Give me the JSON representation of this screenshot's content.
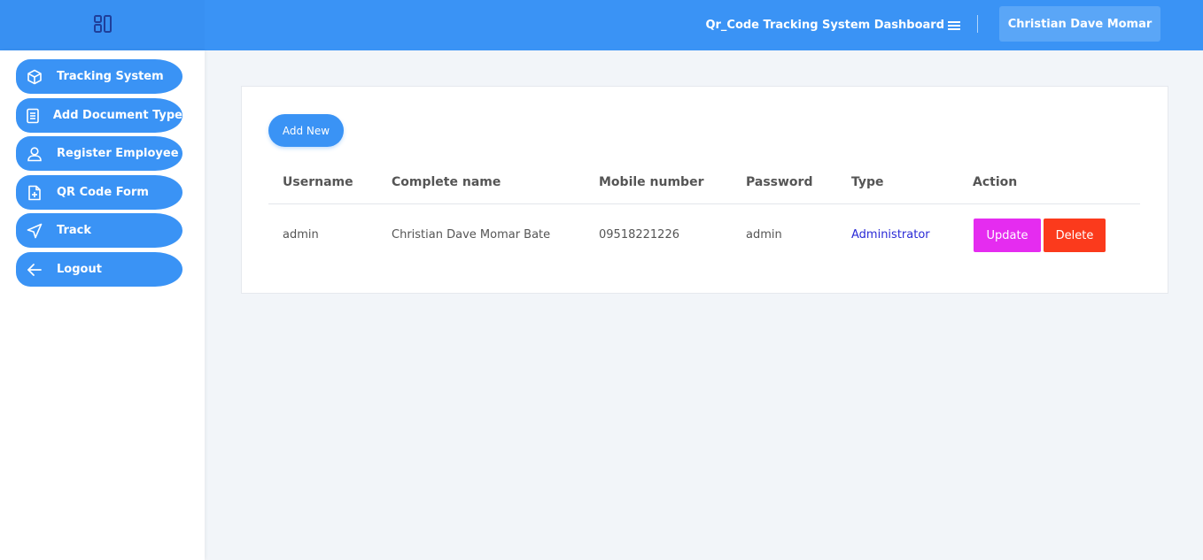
{
  "header": {
    "title": "Qr_Code Tracking System Dashboard",
    "user": "Christian Dave Momar",
    "accent": "#3a93f5"
  },
  "sidebar": {
    "items": [
      {
        "label": "Tracking System",
        "icon": "box-icon"
      },
      {
        "label": "Add Document Type",
        "icon": "document-icon"
      },
      {
        "label": "Register Employee",
        "icon": "user-icon"
      },
      {
        "label": "QR Code Form",
        "icon": "file-plus-icon"
      },
      {
        "label": "Track",
        "icon": "navigation-icon"
      },
      {
        "label": "Logout",
        "icon": "arrow-left-icon"
      }
    ]
  },
  "main": {
    "add_label": "Add New",
    "table": {
      "columns": [
        "Username",
        "Complete name",
        "Mobile number",
        "Password",
        "Type",
        "Action"
      ],
      "rows": [
        {
          "username": "admin",
          "complete_name": "Christian Dave Momar Bate",
          "mobile": "09518221226",
          "password": "admin",
          "type": "Administrator",
          "update_label": "Update",
          "delete_label": "Delete"
        }
      ]
    }
  }
}
